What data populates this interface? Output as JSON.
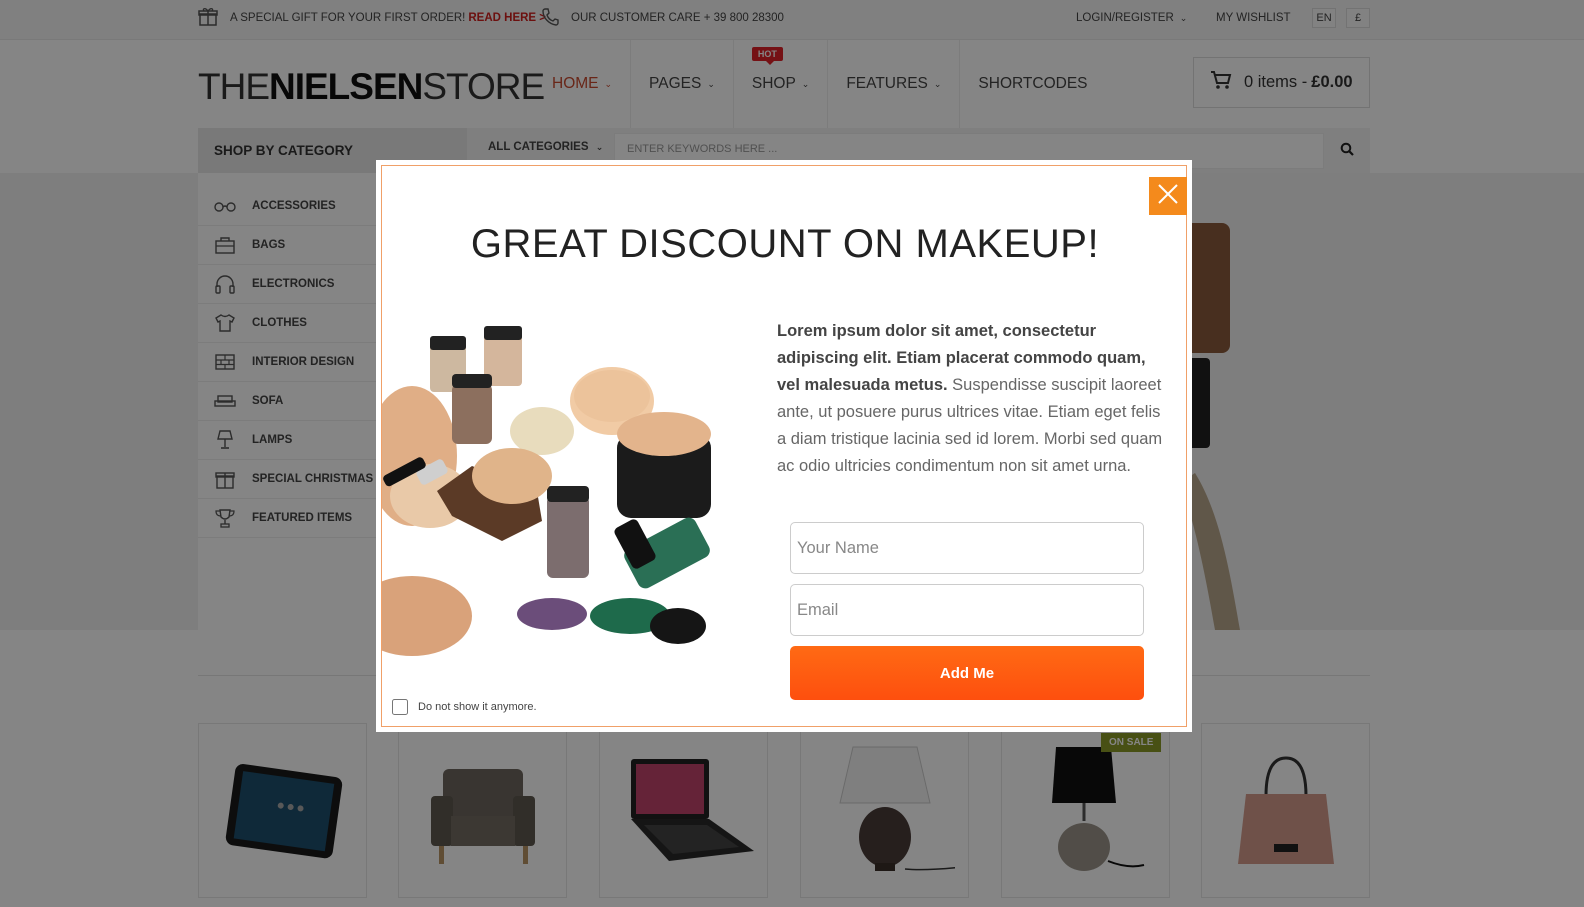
{
  "topbar": {
    "gift_text": "A SPECIAL GIFT FOR YOUR FIRST ORDER!",
    "read_here": "READ HERE >",
    "customer_care": "OUR CUSTOMER CARE + 39 800 28300",
    "login": "LOGIN/REGISTER",
    "wishlist": "MY WISHLIST",
    "lang": "EN",
    "currency": "£"
  },
  "header": {
    "logo_the": "THE",
    "logo_nielsen": "NIELSEN",
    "logo_store": "STORE",
    "nav": [
      {
        "label": "HOME",
        "chevron": "⌄"
      },
      {
        "label": "PAGES",
        "chevron": "⌄"
      },
      {
        "label": "SHOP",
        "chevron": "⌄",
        "badge": "HOT"
      },
      {
        "label": "FEATURES",
        "chevron": "⌄"
      },
      {
        "label": "SHORTCODES"
      }
    ],
    "cart_items": "0 items -",
    "cart_total": "£0.00"
  },
  "search": {
    "shop_by_category": "SHOP BY CATEGORY",
    "all_categories": "ALL CATEGORIES",
    "placeholder": "ENTER KEYWORDS HERE ..."
  },
  "sidebar": {
    "items": [
      {
        "label": "ACCESSORIES",
        "icon": "glasses-icon"
      },
      {
        "label": "BAGS",
        "icon": "bag-icon"
      },
      {
        "label": "ELECTRONICS",
        "icon": "headphones-icon"
      },
      {
        "label": "CLOTHES",
        "icon": "tshirt-icon"
      },
      {
        "label": "INTERIOR DESIGN",
        "icon": "brick-icon"
      },
      {
        "label": "SOFA",
        "icon": "sofa-icon"
      },
      {
        "label": "LAMPS",
        "icon": "lamp-icon"
      },
      {
        "label": "SPECIAL CHRISTMAS",
        "icon": "gift-icon"
      },
      {
        "label": "FEATURED ITEMS",
        "icon": "trophy-icon"
      }
    ]
  },
  "products": {
    "on_sale": "ON SALE"
  },
  "modal": {
    "title": "GREAT DISCOUNT ON MAKEUP!",
    "body_bold": "Lorem ipsum dolor sit amet, consectetur adipiscing elit. Etiam placerat commodo quam, vel malesuada metus.",
    "body_regular": " Suspendisse suscipit laoreet ante, ut posuere purus ultrices vitae. Etiam eget felis a diam tristique lacinia sed id lorem. Morbi sed quam ac odio ultricies condimentum non sit amet urna.",
    "name_placeholder": "Your Name",
    "email_placeholder": "Email",
    "submit_label": "Add Me",
    "dont_show": "Do not show it anymore."
  },
  "colors": {
    "accent_orange": "#ff5a12",
    "close_orange": "#f48a1c",
    "home_active": "#c94a2f",
    "hot_red": "#e0222a",
    "sale_green": "#8a9a27"
  }
}
